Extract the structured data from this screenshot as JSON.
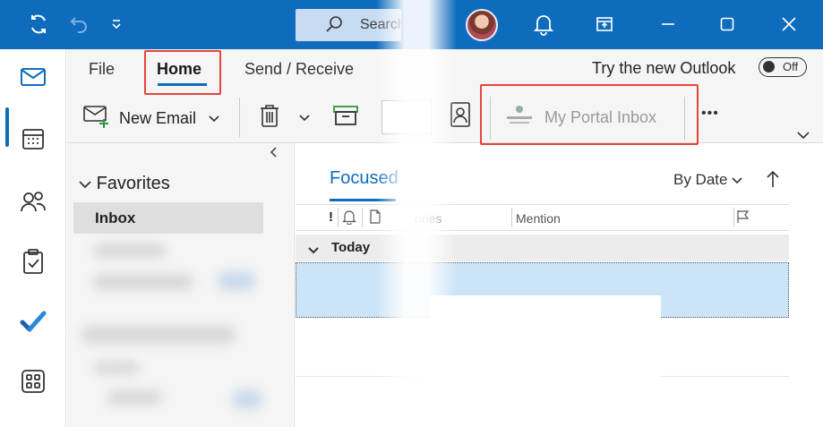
{
  "titlebar": {
    "search_placeholder": "Search",
    "icons": [
      "sync-icon",
      "undo-icon",
      "customize-toolbar-icon",
      "search-icon",
      "bell-icon",
      "restore-window-icon",
      "minimize-icon",
      "maximize-icon",
      "close-icon"
    ]
  },
  "ribbon": {
    "tabs": [
      {
        "label": "File"
      },
      {
        "label": "Home",
        "active": true
      },
      {
        "label": "Send / Receive"
      }
    ],
    "try_new_outlook": "Try the new Outlook",
    "toggle_label": "Off",
    "new_email": "New Email",
    "my_portal_inbox": "My Portal Inbox",
    "more": "•••"
  },
  "folders": {
    "favorites": "Favorites",
    "inbox": "Inbox"
  },
  "message_list": {
    "focused_tab": "Focused",
    "sort_label": "By Date",
    "columns": {
      "categories": "ories",
      "mention": "Mention"
    },
    "group_today": "Today"
  },
  "colors": {
    "accent": "#0f6cbd",
    "highlight_box": "#e4463d",
    "selection": "#cce4f7"
  }
}
